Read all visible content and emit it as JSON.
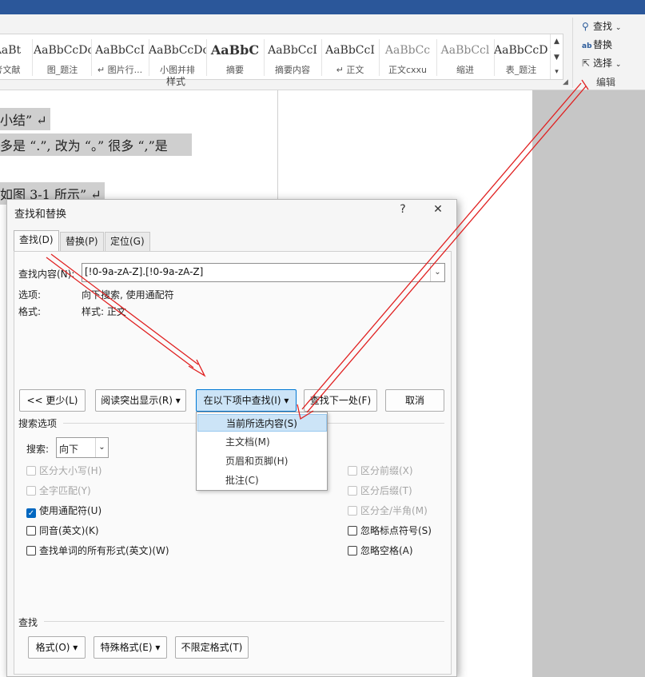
{
  "ribbon": {
    "styles": [
      {
        "sample": "AaBt",
        "name": "考文献"
      },
      {
        "sample": "AaBbCcDc",
        "name": "图_题注"
      },
      {
        "sample": "AaBbCcI",
        "name": "↵ 图片行..."
      },
      {
        "sample": "AaBbCcDc",
        "name": "小图并排"
      },
      {
        "sample": "AaBbC",
        "name": "摘要"
      },
      {
        "sample": "AaBbCcI",
        "name": "摘要内容"
      },
      {
        "sample": "AaBbCcI",
        "name": "↵ 正文"
      },
      {
        "sample": "AaBbCc",
        "name": "正文cxxu"
      },
      {
        "sample": "AaBbCcl",
        "name": "缩进"
      },
      {
        "sample": "AaBbCcDc",
        "name": "表_题注"
      }
    ],
    "styles_group_label": "样式",
    "edit_group_label": "编辑",
    "find_label": "查找",
    "replace_label": "替换",
    "select_label": "选择"
  },
  "document": {
    "lines": [
      "小结” ↵",
      "多是 “.”, 改为 “。”   很多 “,”是",
      "如图 3-1 所示” ↵"
    ]
  },
  "dialog": {
    "title": "查找和替换",
    "help": "?",
    "close": "✕",
    "tabs": [
      "查找(D)",
      "替换(P)",
      "定位(G)"
    ],
    "find_what_label": "查找内容(N):",
    "find_what_value": "[!0-9a-zA-Z].[!0-9a-zA-Z]",
    "options_label": "选项:",
    "options_value": "向下搜索, 使用通配符",
    "format_label": "格式:",
    "format_value": "样式: 正文",
    "buttons": {
      "less": "<< 更少(L)",
      "reading_highlight": "阅读突出显示(R) ▾",
      "find_in": "在以下项中查找(I) ▾",
      "find_next": "查找下一处(F)",
      "cancel": "取消"
    },
    "search_options_label": "搜索选项",
    "search_label": "搜索:",
    "search_direction": "向下",
    "checkboxes_left": [
      {
        "label": "区分大小写(H)",
        "checked": false,
        "enabled": false
      },
      {
        "label": "全字匹配(Y)",
        "checked": false,
        "enabled": false
      },
      {
        "label": "使用通配符(U)",
        "checked": true,
        "enabled": true
      },
      {
        "label": "同音(英文)(K)",
        "checked": false,
        "enabled": true
      },
      {
        "label": "查找单词的所有形式(英文)(W)",
        "checked": false,
        "enabled": true
      }
    ],
    "checkboxes_right": [
      {
        "label": "区分前缀(X)",
        "checked": false,
        "enabled": false
      },
      {
        "label": "区分后缀(T)",
        "checked": false,
        "enabled": false
      },
      {
        "label": "区分全/半角(M)",
        "checked": false,
        "enabled": false
      },
      {
        "label": "忽略标点符号(S)",
        "checked": false,
        "enabled": true
      },
      {
        "label": "忽略空格(A)",
        "checked": false,
        "enabled": true
      }
    ],
    "find_section_label": "查找",
    "bottom_buttons": {
      "format": "格式(O) ▾",
      "special": "特殊格式(E) ▾",
      "no_format": "不限定格式(T)"
    },
    "find_in_menu": [
      "当前所选内容(S)",
      "主文档(M)",
      "页眉和页脚(H)",
      "批注(C)"
    ]
  },
  "colors": {
    "accent": "#0067c0",
    "arrow": "#e02020",
    "titlebar": "#2b579a"
  }
}
